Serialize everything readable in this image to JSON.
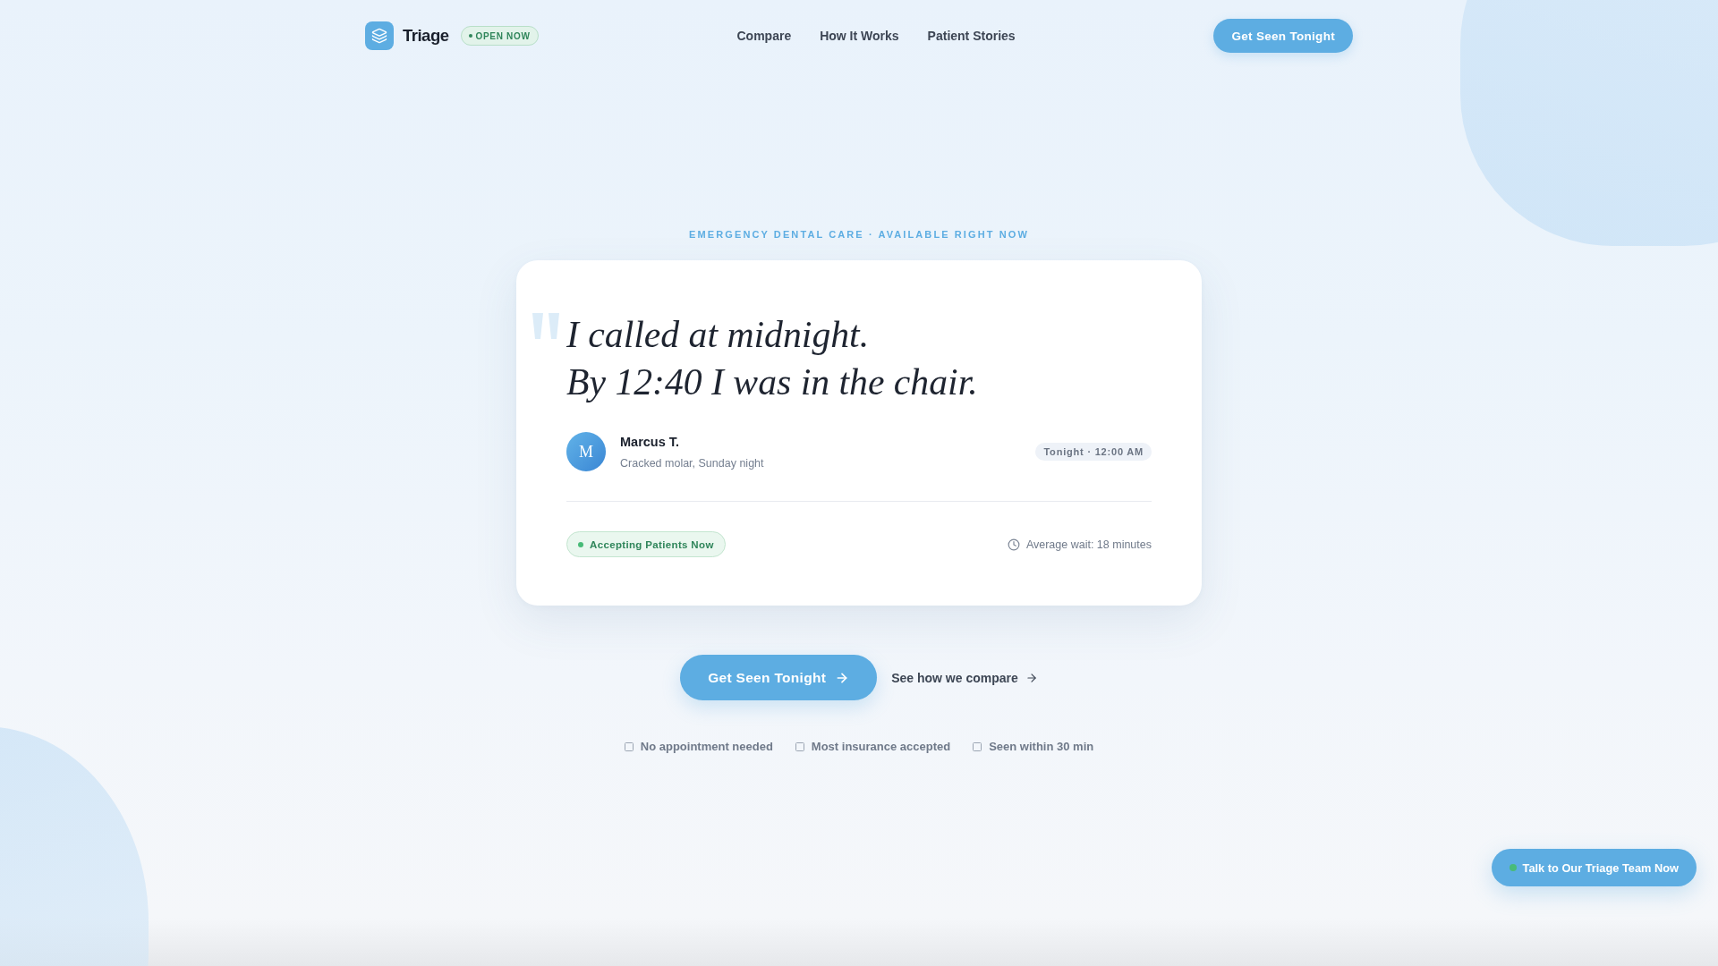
{
  "header": {
    "logo": {
      "name": "Triage"
    },
    "status_badge": {
      "label": "OPEN NOW"
    },
    "nav_links": [
      {
        "label": "Compare"
      },
      {
        "label": "How It Works"
      },
      {
        "label": "Patient Stories"
      }
    ],
    "cta": {
      "label": "Get Seen Tonight"
    }
  },
  "hero": {
    "eyebrow": "EMERGENCY DENTAL CARE · AVAILABLE RIGHT NOW",
    "testimonial": {
      "quote_lines": [
        "I called at midnight.",
        "By 12:40 I was in the chair."
      ],
      "author": {
        "initial": "M",
        "name": "Marcus T.",
        "detail": "Cracked molar, Sunday night"
      },
      "time_tag": "Tonight · 12:00 AM",
      "status": {
        "label": "Accepting Patients Now"
      },
      "wait": "Average wait: 18 minutes"
    },
    "primary_button": {
      "label": "Get Seen Tonight"
    },
    "secondary_link": {
      "label": "See how we compare"
    },
    "features": [
      {
        "label": "No appointment needed"
      },
      {
        "label": "Most insurance accepted"
      },
      {
        "label": "Seen within 30 min"
      }
    ]
  },
  "chat_button": {
    "label": "Talk to Our Triage Team Now"
  }
}
